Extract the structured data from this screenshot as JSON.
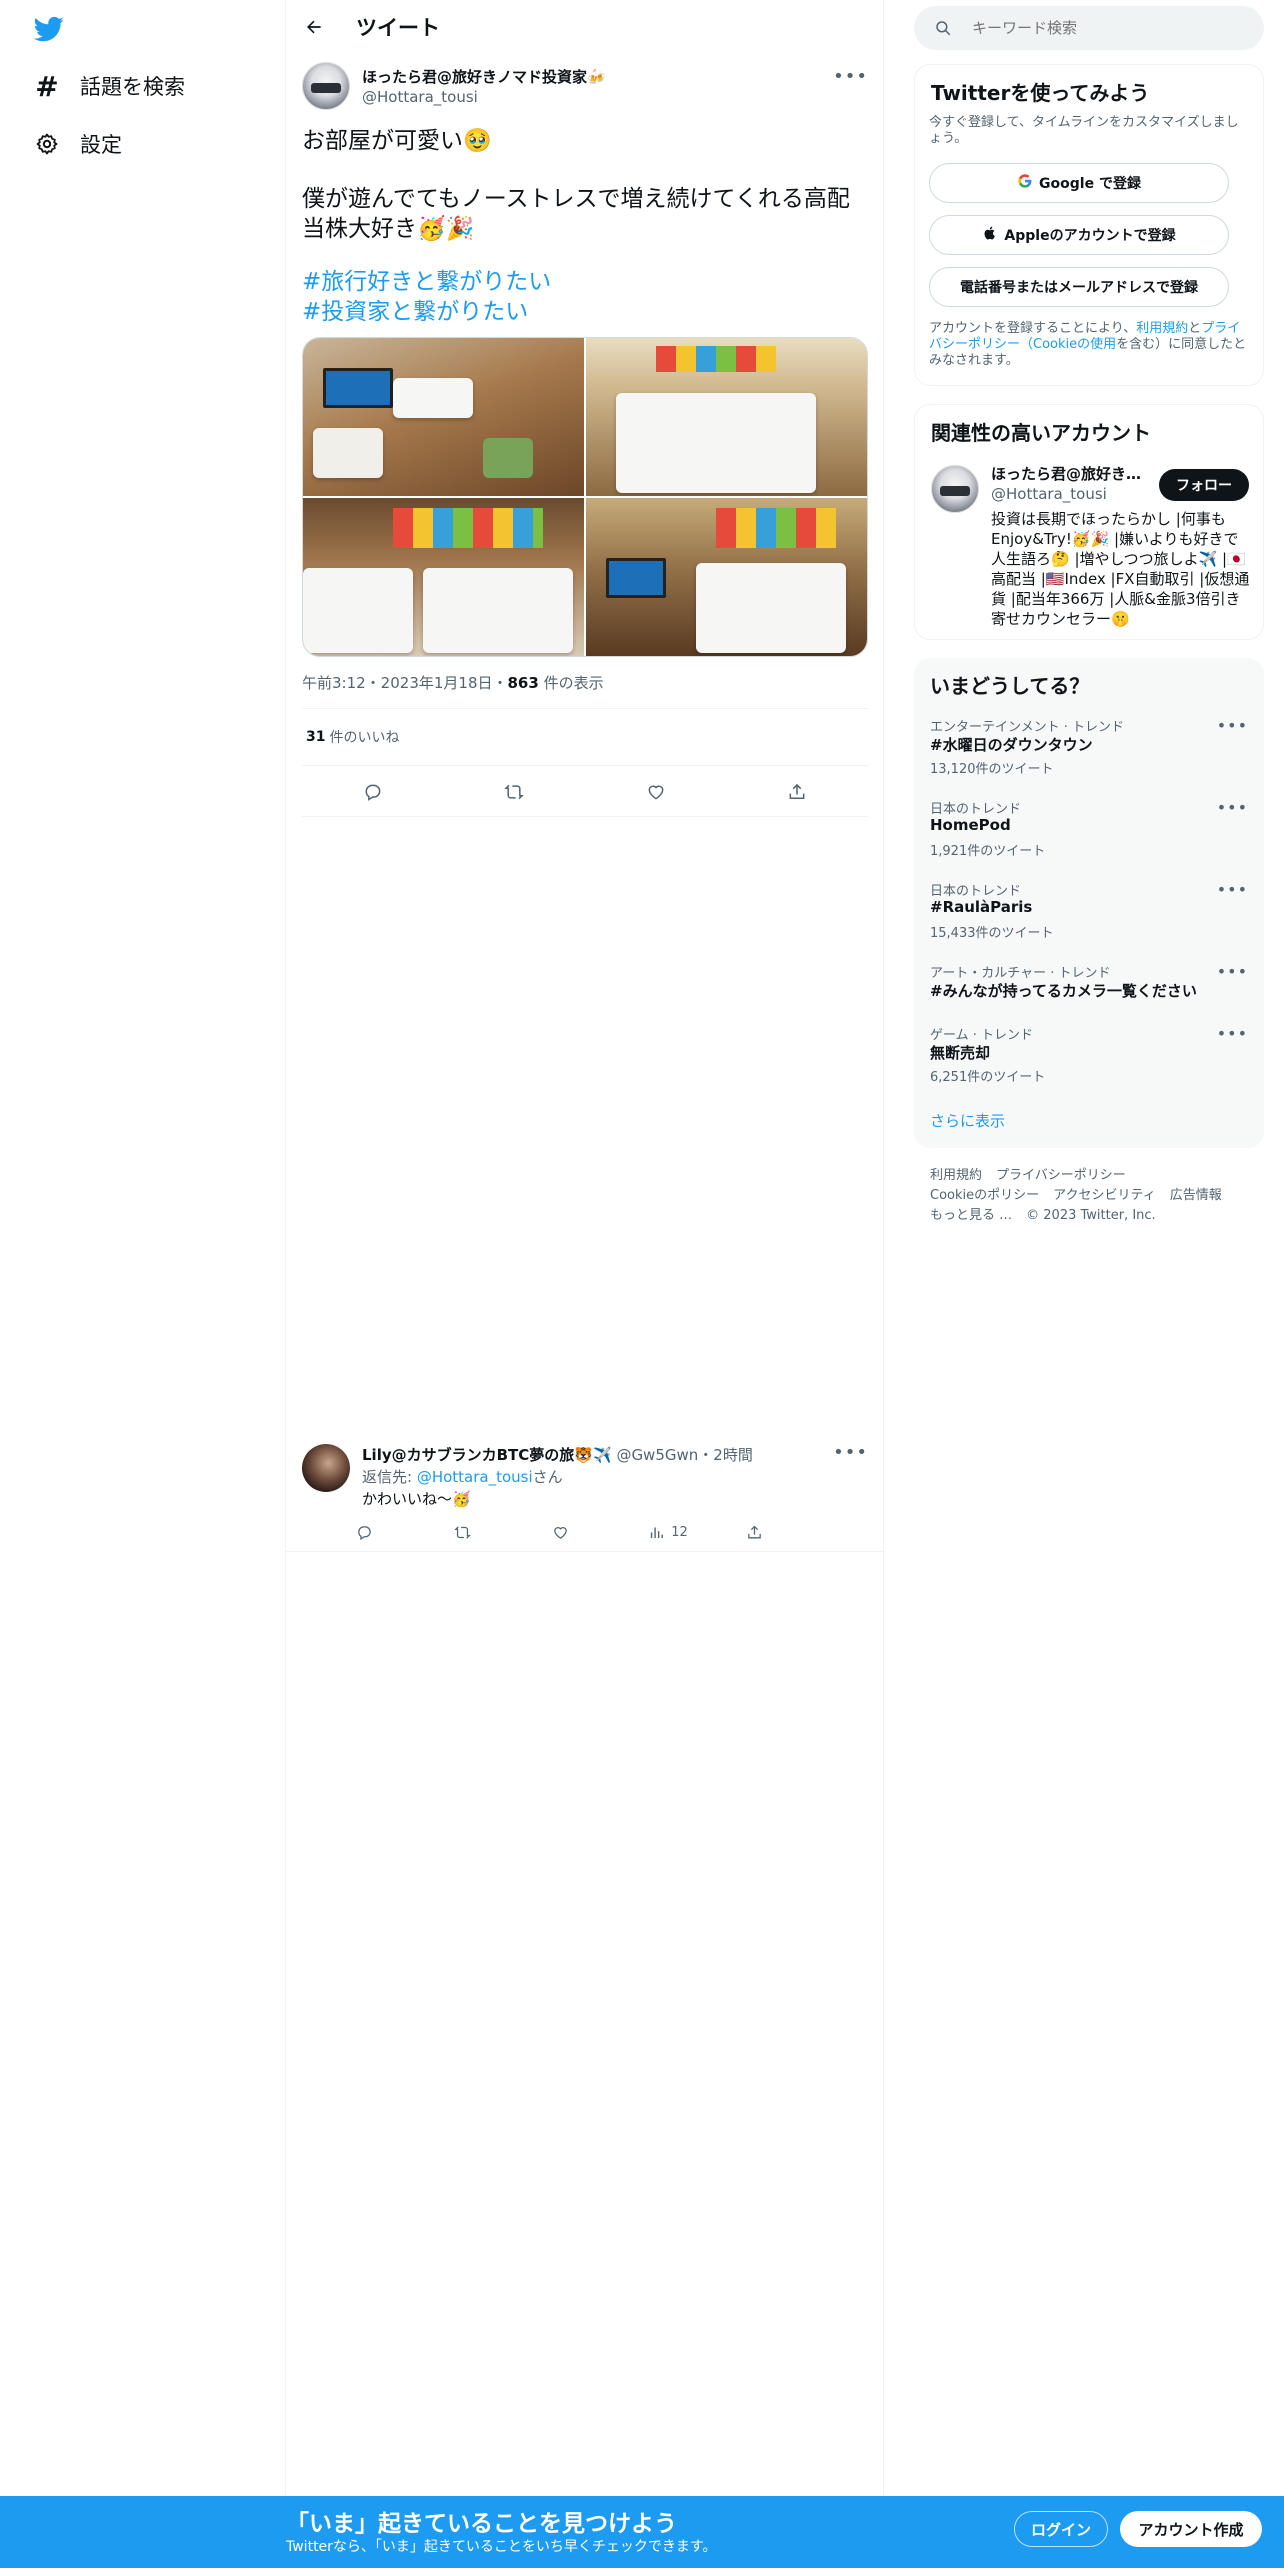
{
  "nav": {
    "items": [
      {
        "icon": "hashtag-icon",
        "label": "話題を検索"
      },
      {
        "icon": "gear-icon",
        "label": "設定"
      }
    ]
  },
  "header": {
    "title": "ツイート"
  },
  "tweet": {
    "name": "ほったら君@旅好きノマド投資家🍻",
    "handle": "@Hottara_tousi",
    "text_line1": "お部屋が可愛い🥹",
    "text_line2": "僕が遊んでてもノーストレスで増え続けてくれる高配当株大好き🥳🎉",
    "hashtags": [
      "#旅行好きと繋がりたい",
      "#投資家と繋がりたい"
    ],
    "time": "午前3:12・2023年1月18日・",
    "views": "863",
    "views_suffix": " 件の表示",
    "likes": "31",
    "likes_suffix": "件のいいね"
  },
  "reply": {
    "name": "Lily@カサブランカBTC夢の旅🐯✈️",
    "handle": "@Gw5Gwn・2時間",
    "reply_prefix": "返信先: ",
    "reply_to": "@Hottara_tousi",
    "reply_suffix": "さん",
    "text": "かわいいね〜🥳",
    "views": "12"
  },
  "search": {
    "placeholder": "キーワード検索"
  },
  "signup": {
    "title": "Twitterを使ってみよう",
    "subtitle": "今すぐ登録して、タイムラインをカスタマイズしましょう。",
    "google": "Google で登録",
    "apple": "Appleのアカウントで登録",
    "phone": "電話番号またはメールアドレスで登録",
    "terms_1": "アカウントを登録することにより、",
    "terms_link1": "利用規約",
    "terms_2": "と",
    "terms_link2": "プライバシーポリシー（Cookieの使用",
    "terms_3": "を含む）に同意したとみなされます。"
  },
  "relevant": {
    "title": "関連性の高いアカウント",
    "name": "ほったら君@旅好き…",
    "handle": "@Hottara_tousi",
    "follow": "フォロー",
    "bio": "投資は長期でほったらかし |何事もEnjoy&Try!🥳🎉 |嫌いよりも好きで人生語ろ🤔 |増やしつつ旅しよ✈️ |🇯🇵高配当 |🇺🇸Index |FX自動取引 |仮想通貨 |配当年366万 |人脈&金脈3倍引き寄せカウンセラー🤫"
  },
  "trends": {
    "title": "いまどうしてる？",
    "items": [
      {
        "category": "エンターテインメント · トレンド",
        "name": "#水曜日のダウンタウン",
        "count": "13,120件のツイート"
      },
      {
        "category": "日本のトレンド",
        "name": "HomePod",
        "count": "1,921件のツイート"
      },
      {
        "category": "日本のトレンド",
        "name": "#RaulàParis",
        "count": "15,433件のツイート"
      },
      {
        "category": "アート・カルチャー · トレンド",
        "name": "#みんなが持ってるカメラ一覧ください",
        "count": ""
      },
      {
        "category": "ゲーム · トレンド",
        "name": "無断売却",
        "count": "6,251件のツイート"
      }
    ],
    "show_more": "さらに表示"
  },
  "footer": {
    "links": [
      "利用規約",
      "プライバシーポリシー",
      "Cookieのポリシー",
      "アクセシビリティ",
      "広告情報",
      "もっと見る …",
      "© 2023 Twitter, Inc."
    ]
  },
  "bottom": {
    "title": "「いま」起きていることを見つけよう",
    "subtitle": "Twitterなら、「いま」起きていることをいち早くチェックできます。",
    "login": "ログイン",
    "signup": "アカウント作成"
  },
  "colors": {
    "accent": "#1d9bf0",
    "text": "#0f1419",
    "muted": "#536471"
  }
}
